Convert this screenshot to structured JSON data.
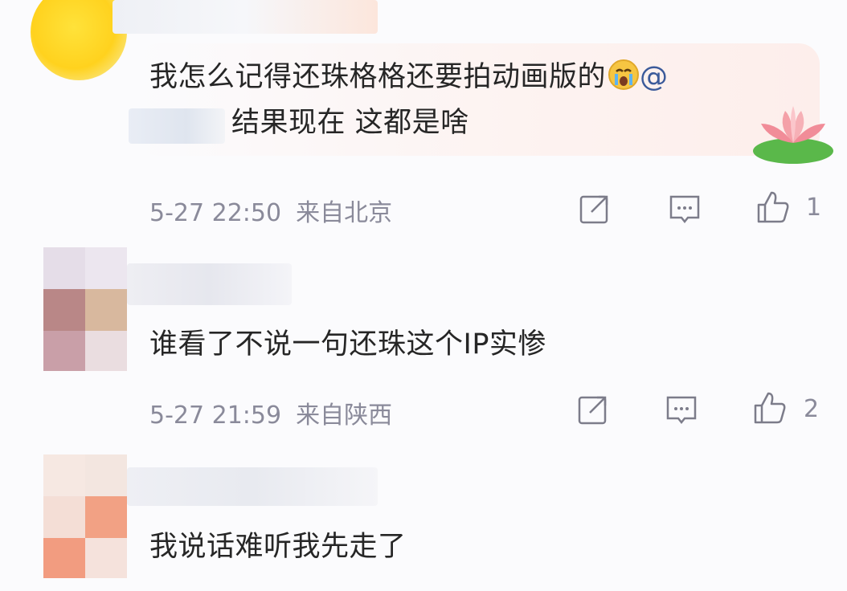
{
  "comments": [
    {
      "text_line1": "我怎么记得还珠格格还要拍动画版的",
      "emoji": "crying-face",
      "at": "@",
      "text_line2": "结果现在 这都是啥",
      "time": "5-27 22:50",
      "location": "来自北京",
      "likes": "1"
    },
    {
      "text": "谁看了不说一句还珠这个IP实惨",
      "time": "5-27 21:59",
      "location": "来自陕西",
      "likes": "2"
    },
    {
      "text": "我说话难听我先走了"
    }
  ],
  "icons": {
    "share": "share-icon",
    "comment": "comment-icon",
    "like": "thumbs-up-icon",
    "decoration": "lotus-icon"
  },
  "colors": {
    "meta": "#8a8a9a",
    "text": "#262626",
    "bubble": "#fdeeeb"
  }
}
